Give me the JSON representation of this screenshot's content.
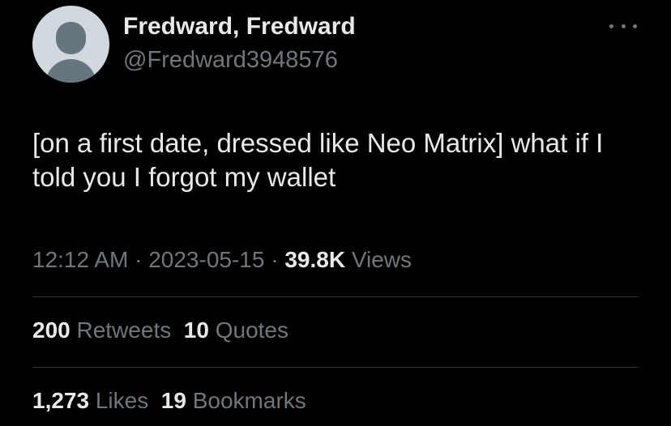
{
  "author": {
    "display_name": "Fredward, Fredward",
    "handle": "@Fredward3948576"
  },
  "tweet": {
    "text": "[on a first date, dressed like Neo Matrix] what if I told you I forgot my wallet",
    "time": "12:12 AM",
    "date": "2023-05-15",
    "views_count": "39.8K",
    "views_label": "Views",
    "separator": "·"
  },
  "stats": {
    "retweets_count": "200",
    "retweets_label": "Retweets",
    "quotes_count": "10",
    "quotes_label": "Quotes",
    "likes_count": "1,273",
    "likes_label": "Likes",
    "bookmarks_count": "19",
    "bookmarks_label": "Bookmarks"
  },
  "icons": {
    "avatar": "default-avatar-icon",
    "more": "more-options-icon"
  },
  "colors": {
    "background": "#000000",
    "text_primary": "#e7e9ea",
    "text_secondary": "#71767b",
    "divider": "#2f3336",
    "avatar_bg": "#cfd9de",
    "avatar_fg": "#67767e"
  }
}
